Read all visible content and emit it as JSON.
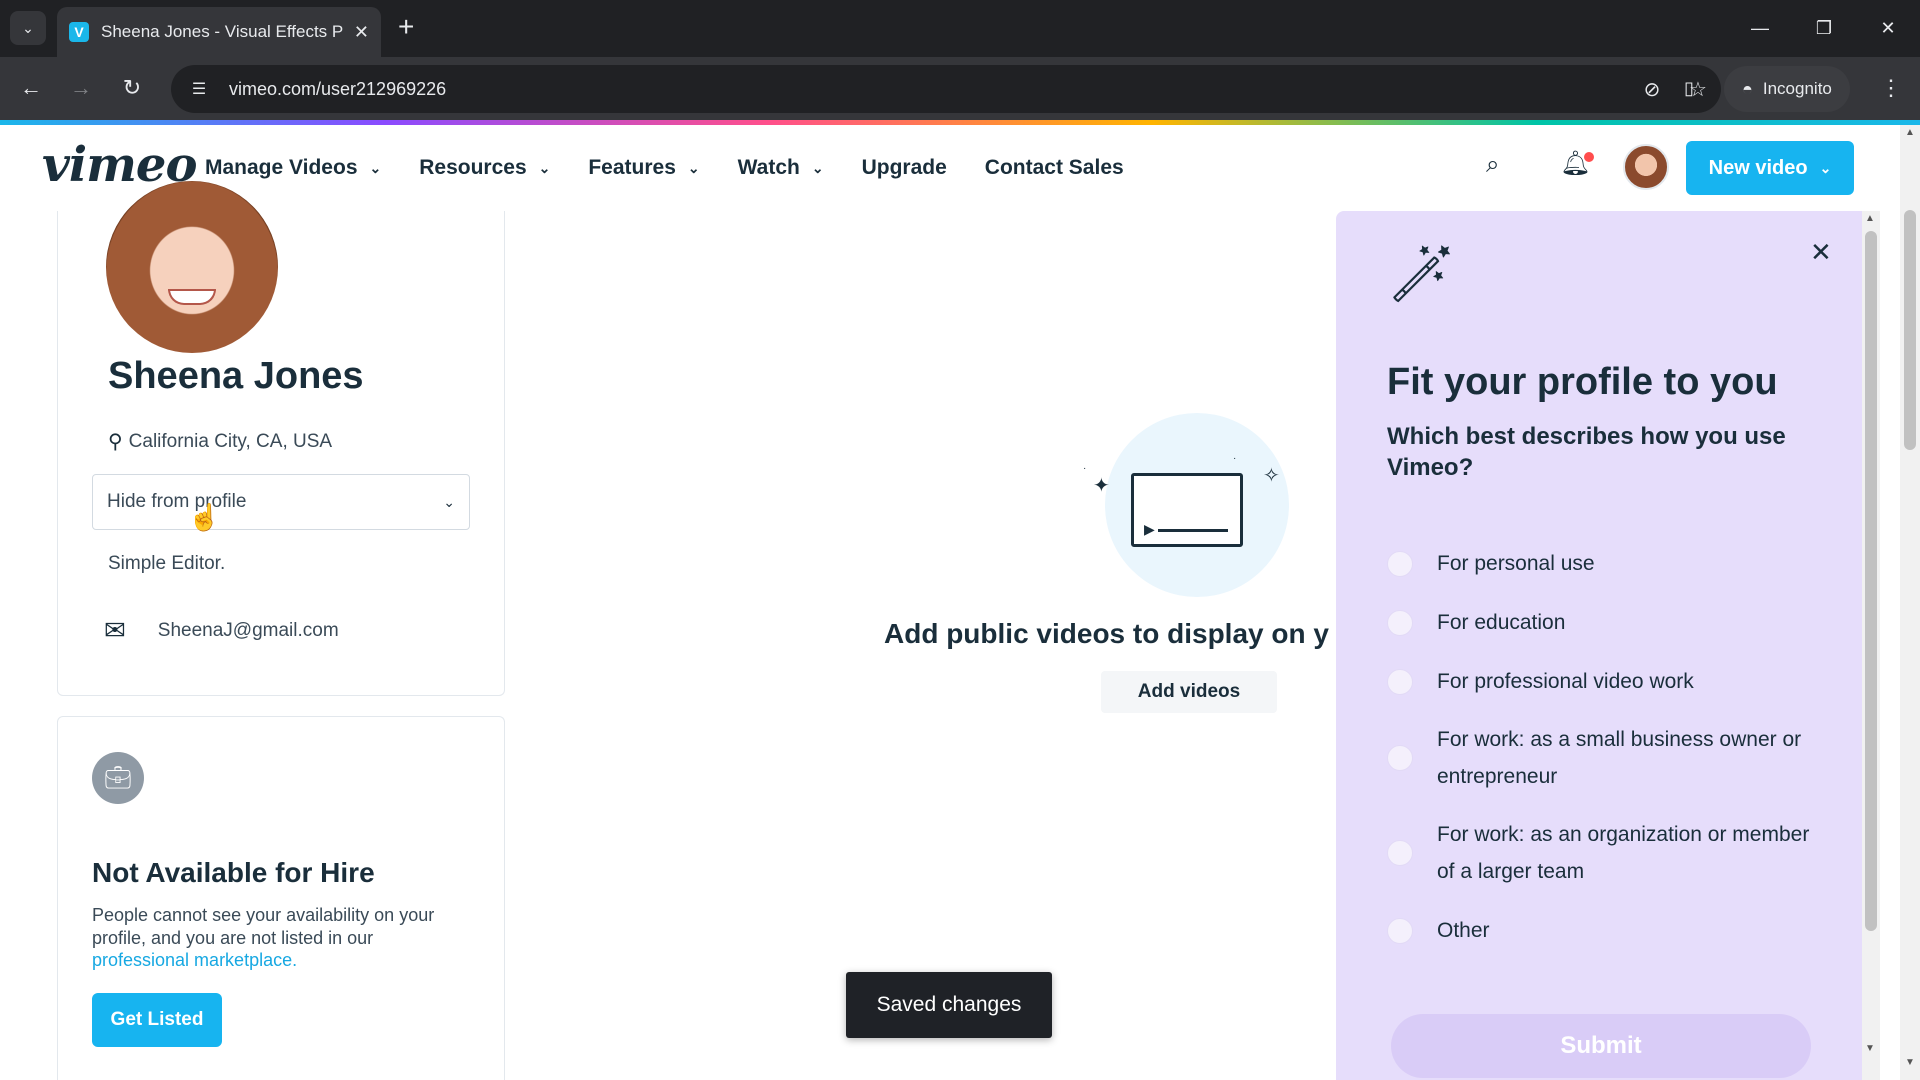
{
  "browser": {
    "tab_title": "Sheena Jones - Visual Effects P",
    "favicon_letter": "V",
    "url": "vimeo.com/user212969226",
    "incognito_label": "Incognito"
  },
  "header": {
    "logo": "vimeo",
    "nav": [
      {
        "label": "Manage Videos",
        "has_dropdown": true
      },
      {
        "label": "Resources",
        "has_dropdown": true
      },
      {
        "label": "Features",
        "has_dropdown": true
      },
      {
        "label": "Watch",
        "has_dropdown": true
      },
      {
        "label": "Upgrade",
        "has_dropdown": false
      },
      {
        "label": "Contact Sales",
        "has_dropdown": false
      }
    ],
    "new_video_label": "New video",
    "accent_color": "#17b4f0"
  },
  "profile": {
    "name": "Sheena Jones",
    "location": "California City, CA, USA",
    "visibility_value": "Hide from profile",
    "editor_note": "Simple Editor.",
    "email": "SheenaJ@gmail.com"
  },
  "hire": {
    "title": "Not Available for Hire",
    "description": "People cannot see your availability on your profile, and you are not listed in our",
    "link_text": "professional marketplace.",
    "button_label": "Get Listed"
  },
  "main": {
    "empty_text": "Add public videos to display on y",
    "add_videos_label": "Add videos",
    "toast": "Saved changes"
  },
  "panel": {
    "title": "Fit your profile to you",
    "subtitle": "Which best describes how you use Vimeo?",
    "options": [
      {
        "label": "For personal use",
        "selected": false
      },
      {
        "label": "For education",
        "selected": false
      },
      {
        "label": "For professional video work",
        "selected": false
      },
      {
        "label": "For work: as a small business owner or entrepreneur",
        "selected": false
      },
      {
        "label": "For work: as an organization or member of a larger team",
        "selected": false
      },
      {
        "label": "Other",
        "selected": false
      }
    ],
    "submit_label": "Submit",
    "background_color": "#e6ddfb"
  }
}
